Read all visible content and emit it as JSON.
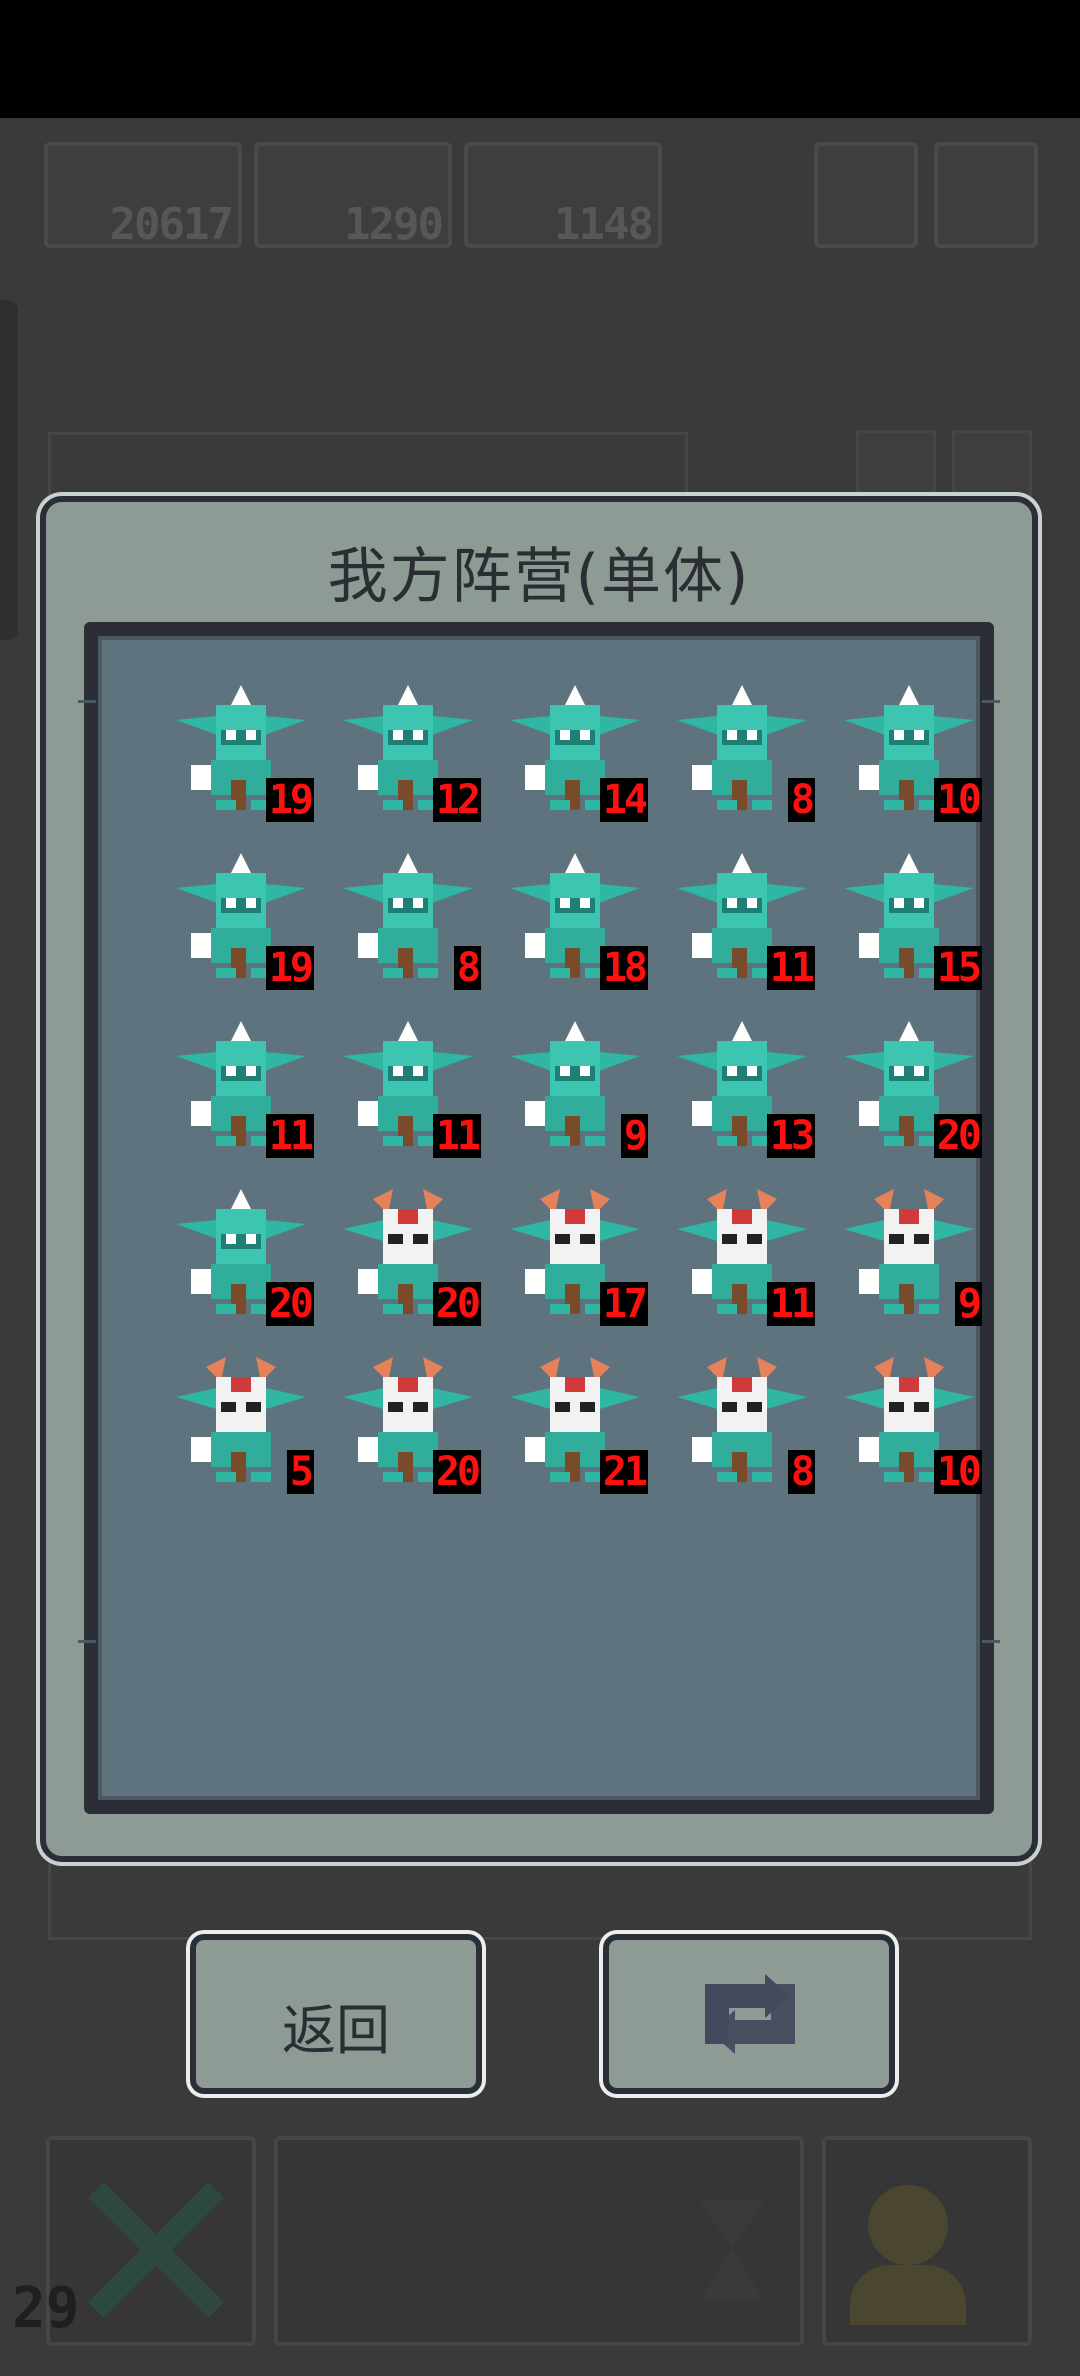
{
  "hud": {
    "resources": [
      {
        "value": "20617"
      },
      {
        "value": "1290"
      },
      {
        "value": "1148"
      }
    ],
    "level": "29"
  },
  "dialog": {
    "title": "我方阵营(单体)",
    "units": [
      {
        "type": "green-goblin",
        "count": "19"
      },
      {
        "type": "green-goblin",
        "count": "12"
      },
      {
        "type": "green-goblin",
        "count": "14"
      },
      {
        "type": "green-goblin",
        "count": "8"
      },
      {
        "type": "green-goblin",
        "count": "10"
      },
      {
        "type": "green-goblin",
        "count": "19"
      },
      {
        "type": "green-goblin",
        "count": "8"
      },
      {
        "type": "green-goblin",
        "count": "18"
      },
      {
        "type": "green-goblin",
        "count": "11"
      },
      {
        "type": "green-goblin",
        "count": "15"
      },
      {
        "type": "green-goblin",
        "count": "11"
      },
      {
        "type": "green-goblin",
        "count": "11"
      },
      {
        "type": "green-goblin",
        "count": "9"
      },
      {
        "type": "green-goblin",
        "count": "13"
      },
      {
        "type": "green-goblin",
        "count": "20"
      },
      {
        "type": "green-goblin",
        "count": "20"
      },
      {
        "type": "masked-goblin",
        "count": "20"
      },
      {
        "type": "masked-goblin",
        "count": "17"
      },
      {
        "type": "masked-goblin",
        "count": "11"
      },
      {
        "type": "masked-goblin",
        "count": "9"
      },
      {
        "type": "masked-goblin",
        "count": "5"
      },
      {
        "type": "masked-goblin",
        "count": "20"
      },
      {
        "type": "masked-goblin",
        "count": "21"
      },
      {
        "type": "masked-goblin",
        "count": "8"
      },
      {
        "type": "masked-goblin",
        "count": "10"
      }
    ]
  },
  "buttons": {
    "back_label": "返回",
    "refresh_icon": "refresh-icon"
  },
  "colors": {
    "panel": "#8e9b94",
    "inner": "#5e737e",
    "count_text": "#ff1010"
  }
}
